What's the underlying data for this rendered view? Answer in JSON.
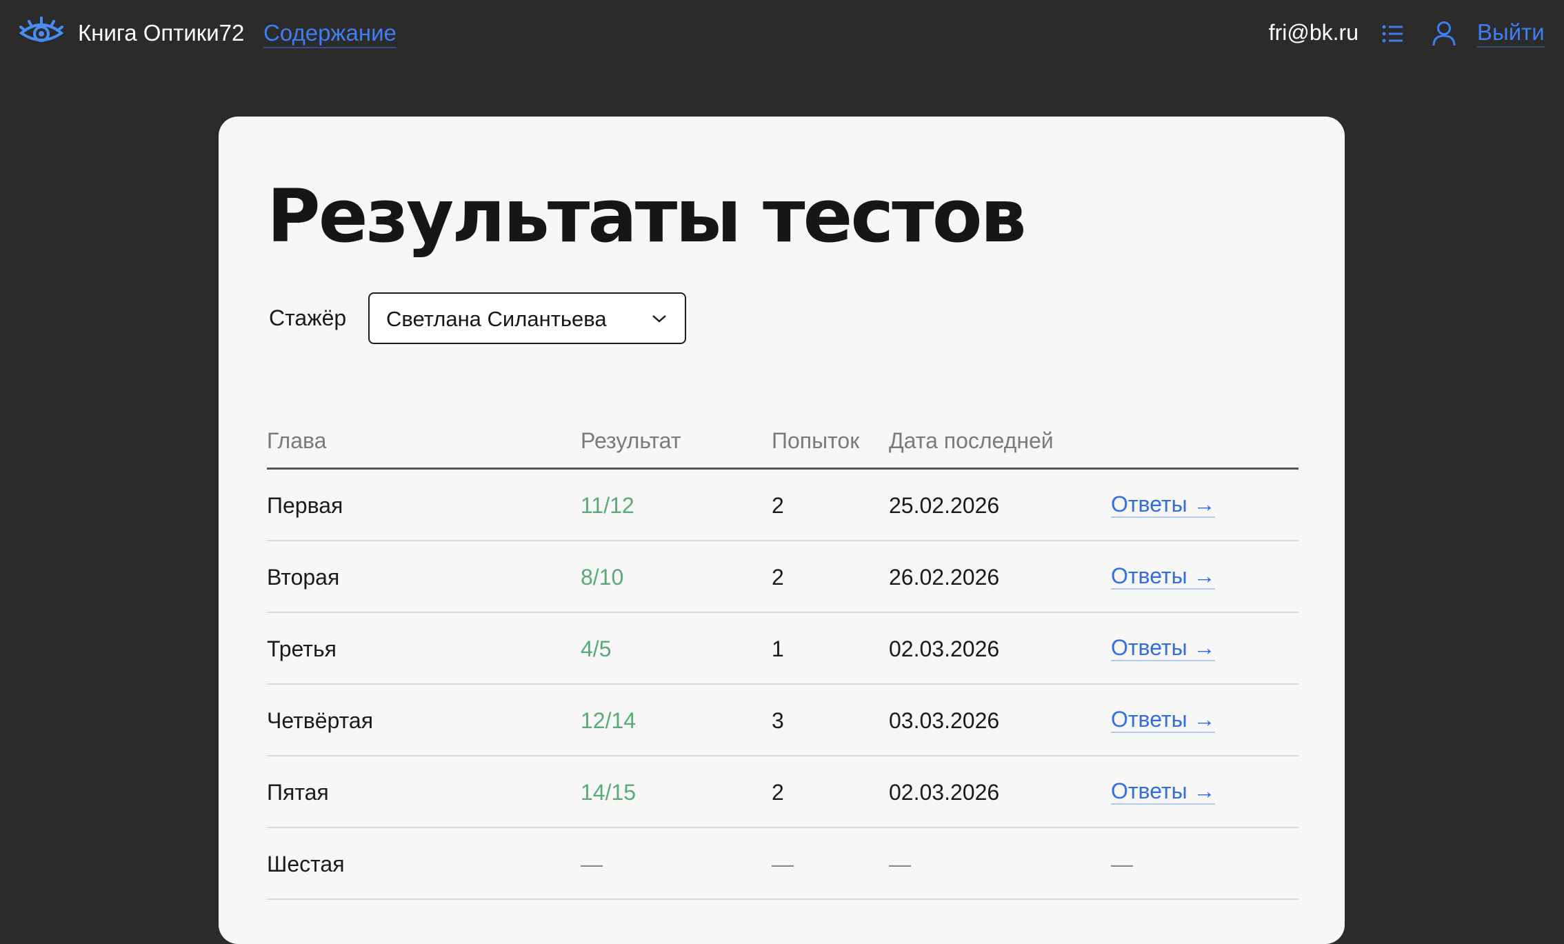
{
  "header": {
    "brand": "Книга Оптики72",
    "toc_link": "Содержание",
    "email": "fri@bk.ru",
    "logout": "Выйти",
    "logo_icon": "eye-icon",
    "list_icon": "list-icon",
    "user_icon": "user-icon",
    "accent_color": "#3f7ef0"
  },
  "page": {
    "title": "Результаты тестов",
    "trainee_label": "Стажёр",
    "trainee_selected": "Светлана Силантьева"
  },
  "table": {
    "headers": [
      "Глава",
      "Результат",
      "Попыток",
      "Дата последней",
      ""
    ],
    "rows": [
      {
        "chapter": "Первая",
        "result": "11/12",
        "attempts": "2",
        "date": "25.02.2026",
        "answers": "Ответы →"
      },
      {
        "chapter": "Вторая",
        "result": "8/10",
        "attempts": "2",
        "date": "26.02.2026",
        "answers": "Ответы →"
      },
      {
        "chapter": "Третья",
        "result": "4/5",
        "attempts": "1",
        "date": "02.03.2026",
        "answers": "Ответы →"
      },
      {
        "chapter": "Четвёртая",
        "result": "12/14",
        "attempts": "3",
        "date": "03.03.2026",
        "answers": "Ответы →"
      },
      {
        "chapter": "Пятая",
        "result": "14/15",
        "attempts": "2",
        "date": "02.03.2026",
        "answers": "Ответы →"
      },
      {
        "chapter": "Шестая",
        "result": "—",
        "attempts": "—",
        "date": "—",
        "answers": "—"
      }
    ],
    "result_color": "#5aaa78",
    "link_color": "#2f6fe0"
  }
}
